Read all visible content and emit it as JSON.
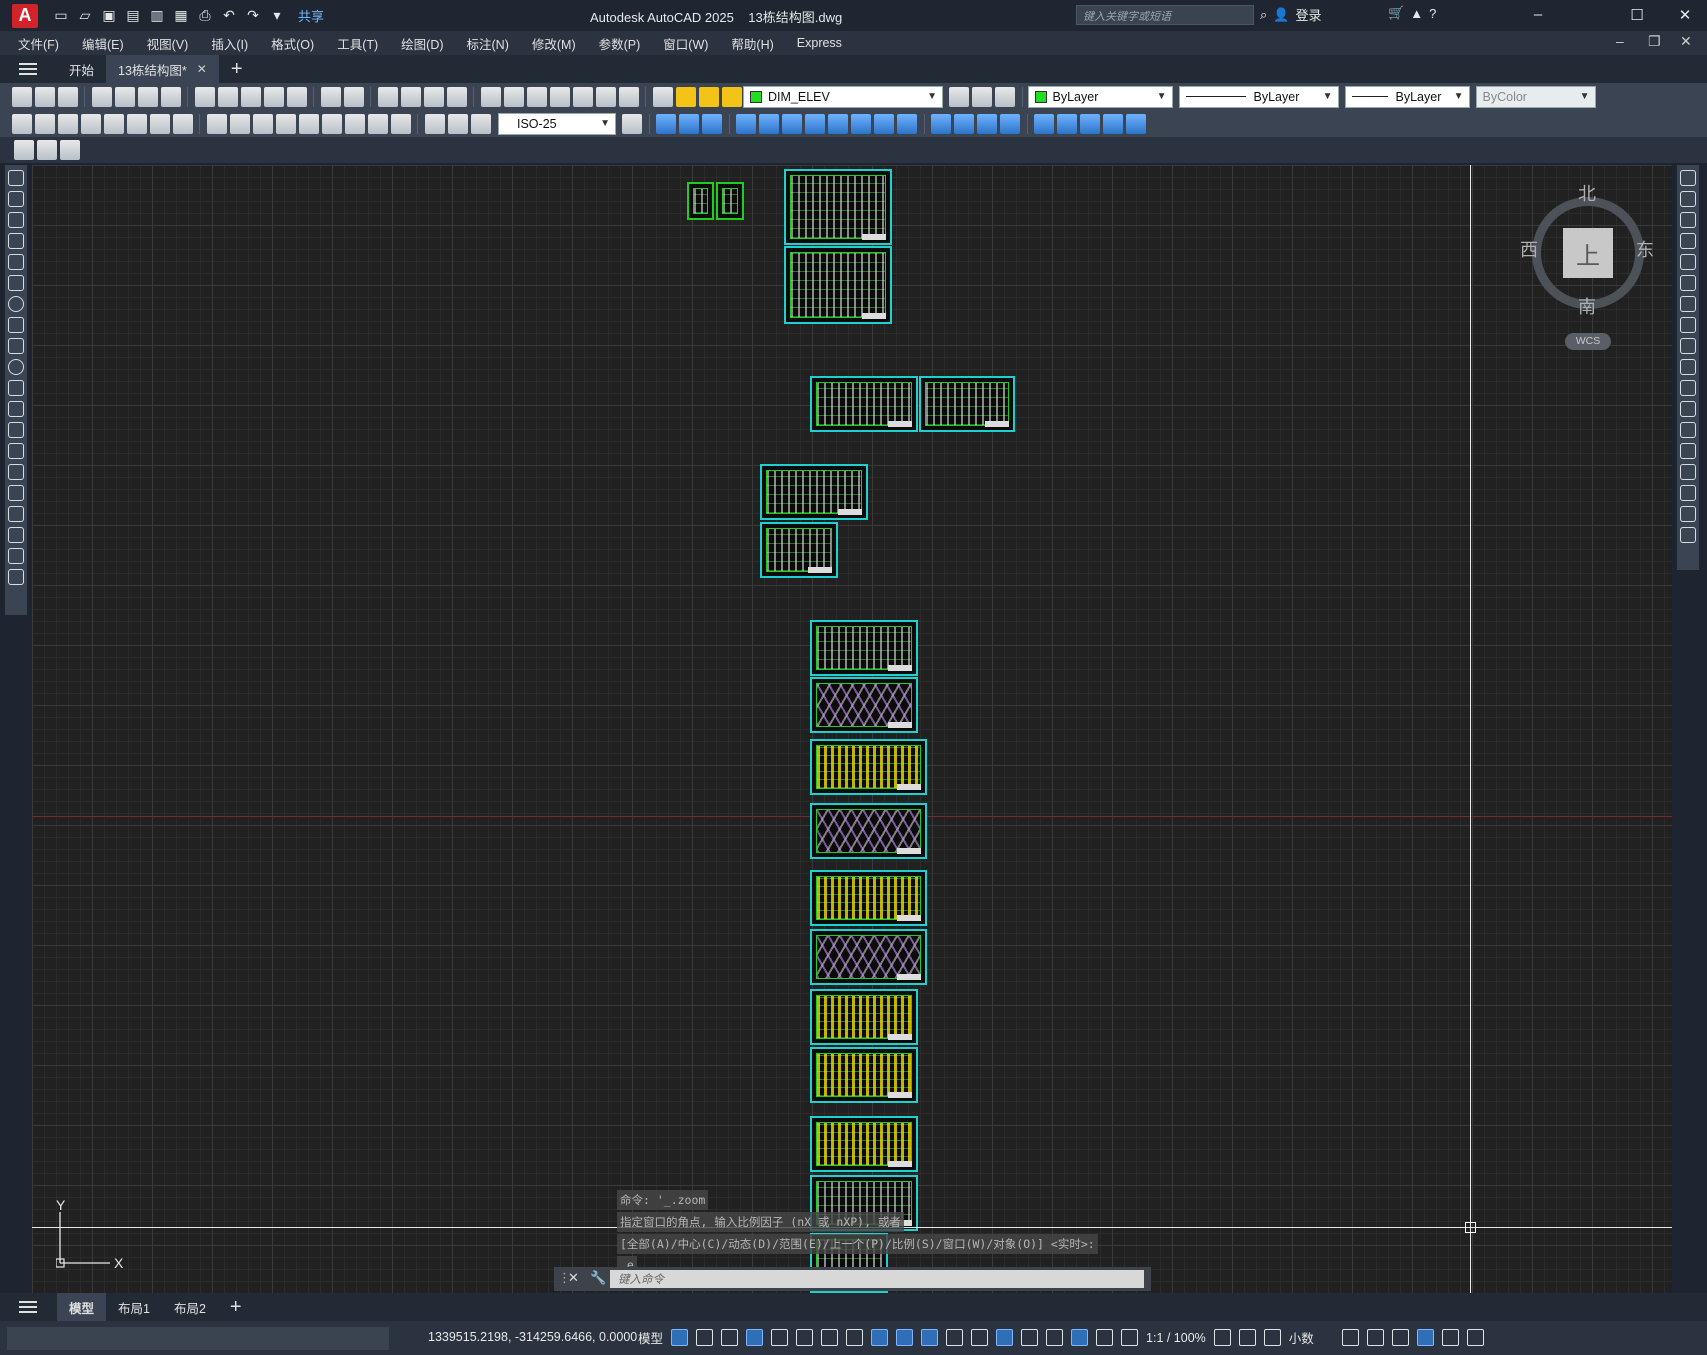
{
  "titlebar": {
    "logo": "A",
    "share": "共享",
    "title": "Autodesk AutoCAD 2025",
    "filename": "13栋结构图.dwg",
    "search_placeholder": "键入关键字或短语",
    "login": "登录"
  },
  "menu": [
    "文件(F)",
    "编辑(E)",
    "视图(V)",
    "插入(I)",
    "格式(O)",
    "工具(T)",
    "绘图(D)",
    "标注(N)",
    "修改(M)",
    "参数(P)",
    "窗口(W)",
    "帮助(H)",
    "Express"
  ],
  "tabs": {
    "start": "开始",
    "file": "13栋结构图*"
  },
  "toolbar": {
    "layer": "DIM_ELEV",
    "layer_color": "#22dd22",
    "color": "ByLayer",
    "linetype": "ByLayer",
    "lineweight": "ByLayer",
    "plotstyle": "ByColor",
    "dimstyle": "ISO-25"
  },
  "viewcube": {
    "north": "北",
    "south": "南",
    "east": "东",
    "west": "西",
    "face": "上",
    "wcs": "WCS"
  },
  "ucs": {
    "x": "X",
    "y": "Y"
  },
  "command": {
    "history": [
      "命令: '_.zoom",
      "指定窗口的角点, 输入比例因子 (nX 或 nXP), 或者",
      "[全部(A)/中心(C)/动态(D)/范围(E)/上一个(P)/比例(S)/窗口(W)/对象(O)] <实时>:",
      "_e"
    ],
    "placeholder": "键入命令"
  },
  "layouts": {
    "model": "模型",
    "layout1": "布局1",
    "layout2": "布局2"
  },
  "status": {
    "coords": "1339515.2198, -314259.6466, 0.0000",
    "mode": "模型",
    "scale": "1:1 / 100%",
    "units": "小数"
  },
  "colors": {
    "accent": "#2f6fb8",
    "sheet_border": "#1fd0d0",
    "canvas": "#212121"
  }
}
